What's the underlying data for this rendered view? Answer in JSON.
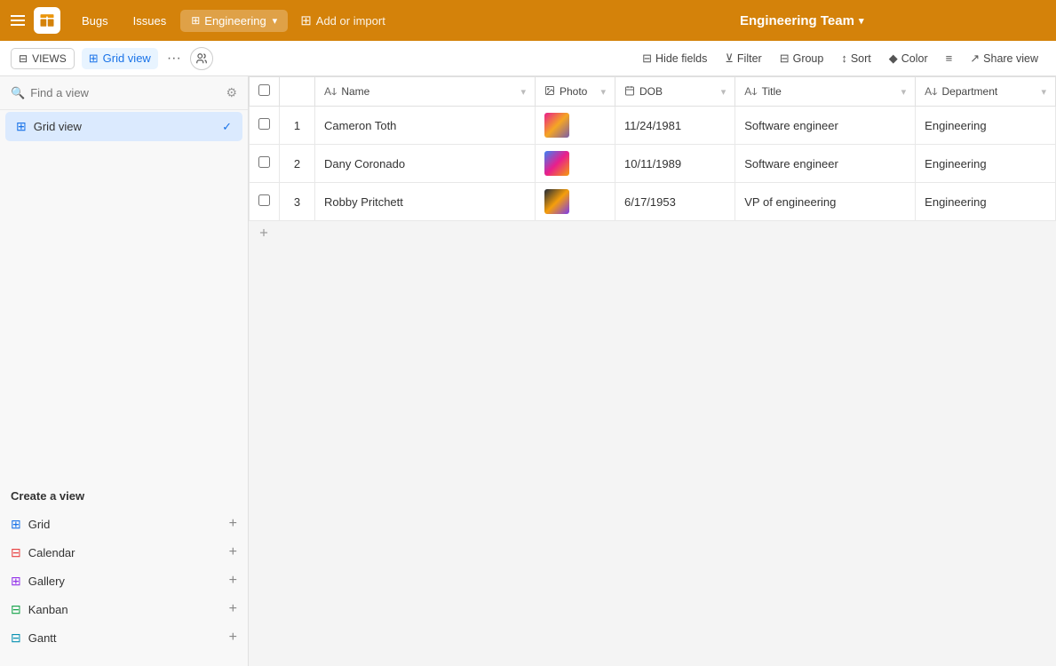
{
  "app": {
    "logo_alt": "Airtable",
    "title": "Engineering Team",
    "title_chevron": "▾"
  },
  "top_bar": {
    "menu_label": "☰",
    "tabs": [
      {
        "label": "Bugs",
        "active": false
      },
      {
        "label": "Issues",
        "active": false
      },
      {
        "label": "Engineering",
        "active": true,
        "icon": "⊞"
      }
    ],
    "add_import_label": "Add or import",
    "add_import_icon": "🞣"
  },
  "toolbar": {
    "views_label": "VIEWS",
    "grid_view_label": "Grid view",
    "more_icon": "•••",
    "collab_icon": "👤",
    "hide_fields_label": "Hide fields",
    "filter_label": "Filter",
    "group_label": "Group",
    "sort_label": "Sort",
    "color_label": "Color",
    "row_height_icon": "≡",
    "share_view_label": "Share view"
  },
  "sidebar": {
    "search_placeholder": "Find a view",
    "views": [
      {
        "label": "Grid view",
        "active": true,
        "icon": "grid"
      }
    ],
    "create_title": "Create a view",
    "create_items": [
      {
        "label": "Grid",
        "icon": "grid"
      },
      {
        "label": "Calendar",
        "icon": "calendar"
      },
      {
        "label": "Gallery",
        "icon": "gallery"
      },
      {
        "label": "Kanban",
        "icon": "kanban"
      },
      {
        "label": "Gantt",
        "icon": "gantt"
      }
    ]
  },
  "table": {
    "columns": [
      {
        "id": "name",
        "label": "Name",
        "icon": "A↑"
      },
      {
        "id": "photo",
        "label": "Photo",
        "icon": "📷"
      },
      {
        "id": "dob",
        "label": "DOB",
        "icon": "📅"
      },
      {
        "id": "title",
        "label": "Title",
        "icon": "A↑"
      },
      {
        "id": "department",
        "label": "Department",
        "icon": "A↑"
      }
    ],
    "rows": [
      {
        "num": "1",
        "name": "Cameron Toth",
        "photo": "photo1",
        "dob": "11/24/1981",
        "title": "Software engineer",
        "department": "Engineering"
      },
      {
        "num": "2",
        "name": "Dany Coronado",
        "photo": "photo2",
        "dob": "10/11/1989",
        "title": "Software engineer",
        "department": "Engineering"
      },
      {
        "num": "3",
        "name": "Robby Pritchett",
        "photo": "photo3",
        "dob": "6/17/1953",
        "title": "VP of engineering",
        "department": "Engineering"
      }
    ]
  }
}
